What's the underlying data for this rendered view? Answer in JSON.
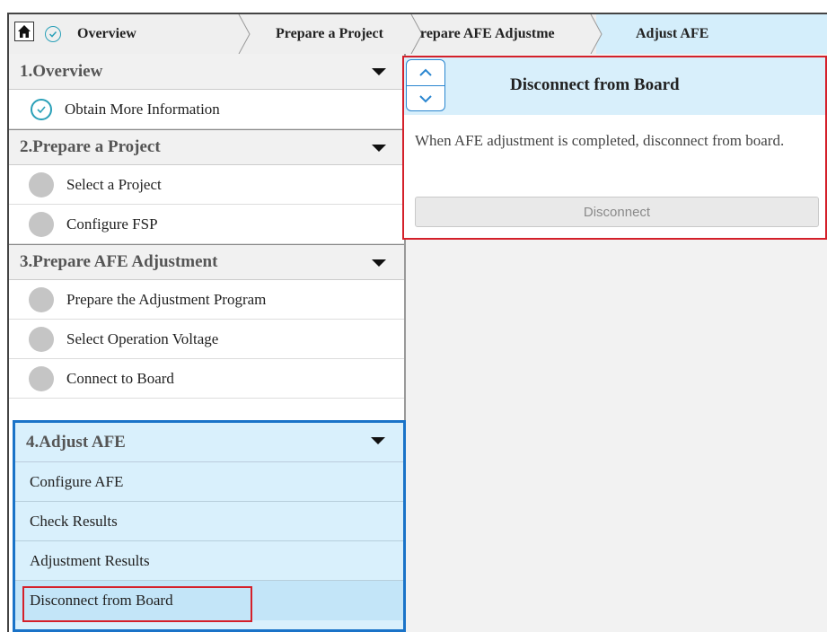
{
  "breadcrumb": {
    "overview": "Overview",
    "prepare_project": "Prepare a Project",
    "prepare_afe": "repare AFE Adjustme",
    "adjust_afe": "Adjust AFE"
  },
  "sections": {
    "s1": {
      "title": "1.Overview",
      "items": [
        "Obtain More Information"
      ]
    },
    "s2": {
      "title": "2.Prepare a Project",
      "items": [
        "Select a Project",
        "Configure FSP"
      ]
    },
    "s3": {
      "title": "3.Prepare AFE Adjustment",
      "items": [
        "Prepare the Adjustment Program",
        "Select Operation Voltage",
        "Connect to Board"
      ]
    },
    "s4": {
      "title": "4.Adjust AFE",
      "items": [
        "Configure AFE",
        "Check Results",
        "Adjustment Results",
        "Disconnect from Board"
      ]
    }
  },
  "panel": {
    "title": "Disconnect from Board",
    "description": "When AFE adjustment is completed, disconnect from board.",
    "button": "Disconnect"
  },
  "colors": {
    "accent_blue": "#1a73c8",
    "highlight_red": "#d4202a",
    "header_bg": "#d8effb"
  }
}
